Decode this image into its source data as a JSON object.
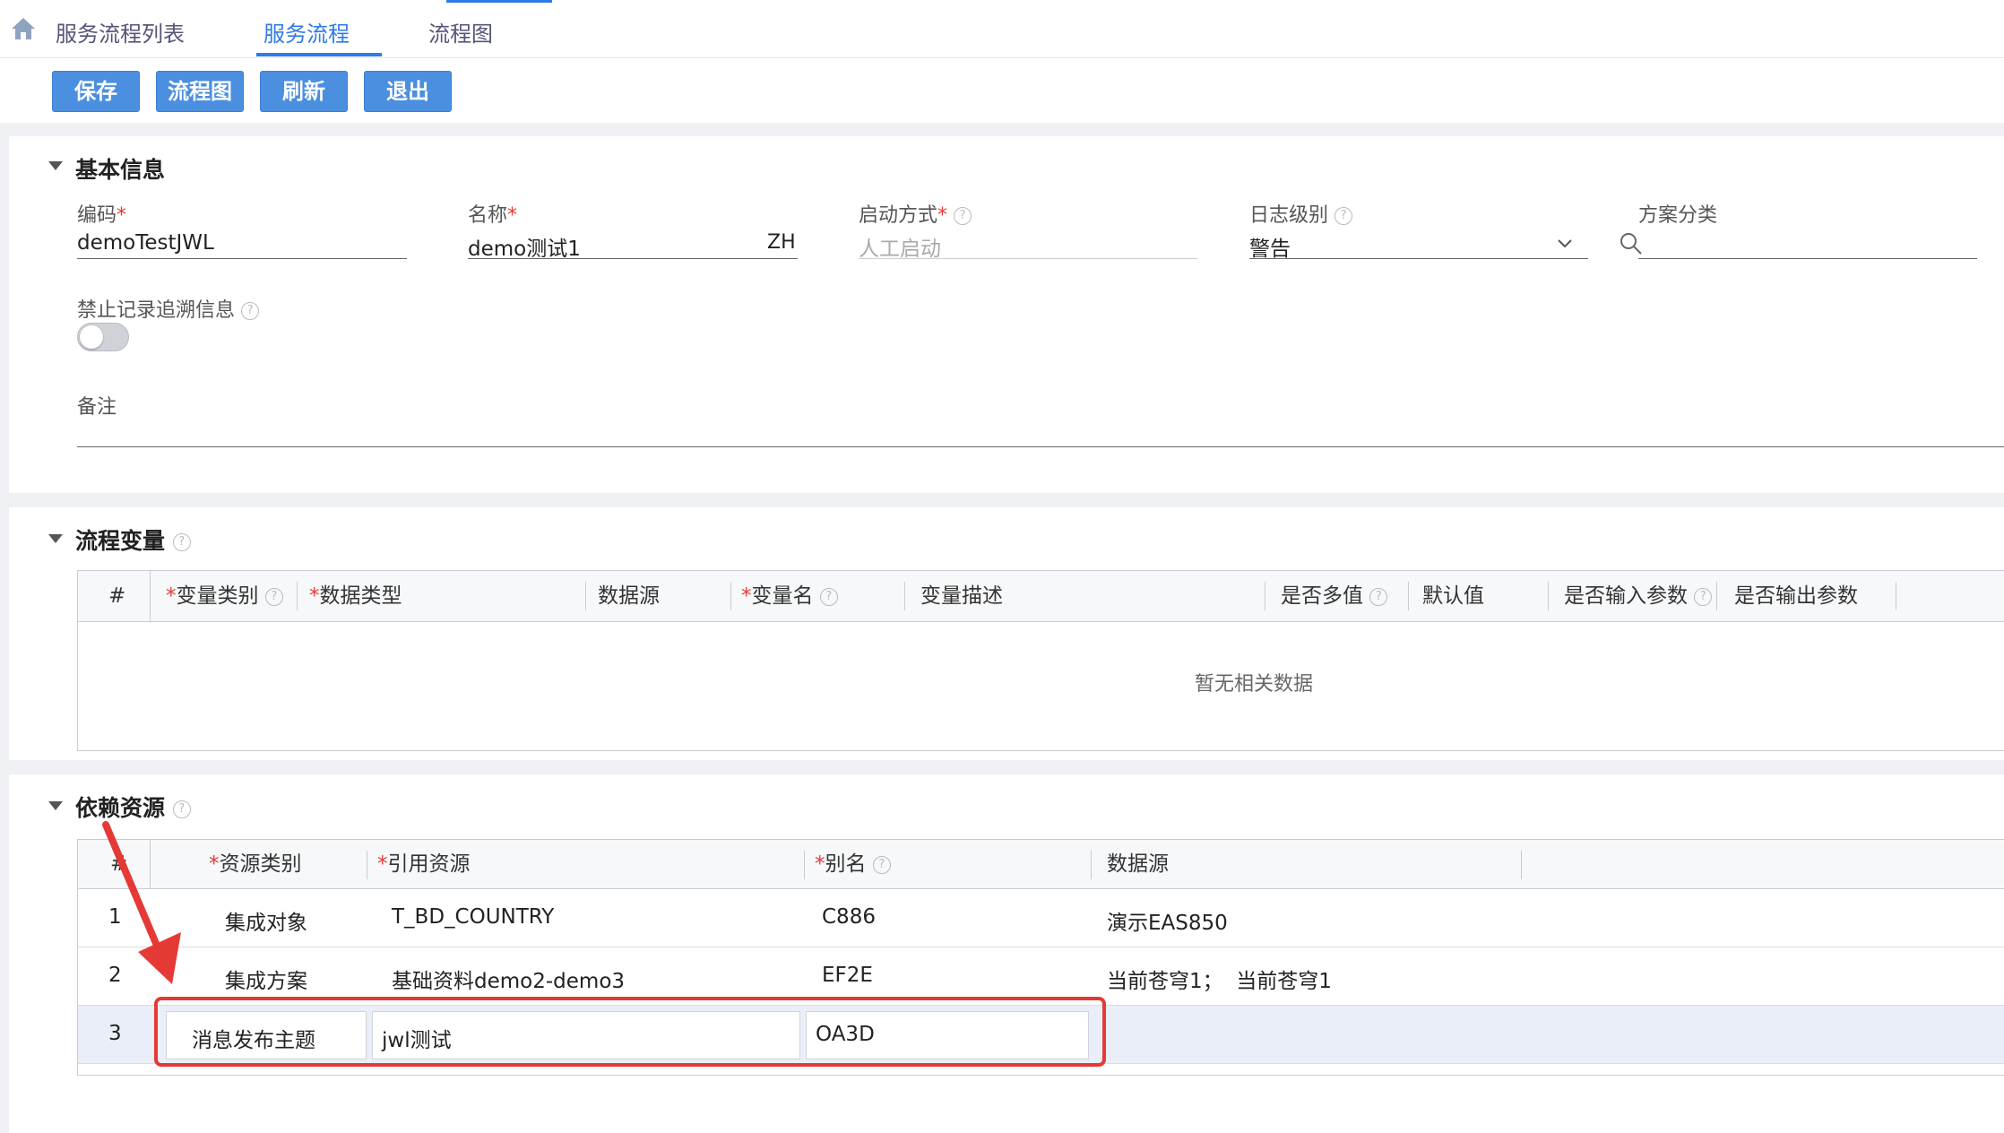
{
  "tabs": {
    "list_label": "服务流程列表",
    "flow_label": "服务流程",
    "chart_label": "流程图"
  },
  "toolbar": {
    "save": "保存",
    "flowchart": "流程图",
    "refresh": "刷新",
    "exit": "退出"
  },
  "basic": {
    "title": "基本信息",
    "code_label": "编码",
    "code_value": "demoTestJWL",
    "name_label": "名称",
    "name_value": "demo测试1",
    "name_lang": "ZH",
    "start_label": "启动方式",
    "start_value": "人工启动",
    "log_label": "日志级别",
    "log_value": "警告",
    "scheme_label": "方案分类",
    "trace_label": "禁止记录追溯信息",
    "remark_label": "备注"
  },
  "vars": {
    "title": "流程变量",
    "headers": [
      "#",
      "变量类别",
      "数据类型",
      "数据源",
      "变量名",
      "变量描述",
      "是否多值",
      "默认值",
      "是否输入参数",
      "是否输出参数"
    ],
    "empty": "暂无相关数据"
  },
  "deps": {
    "title": "依赖资源",
    "headers": [
      "#",
      "资源类别",
      "引用资源",
      "别名",
      "数据源"
    ],
    "rows": [
      {
        "no": "1",
        "type": "集成对象",
        "ref": "T_BD_COUNTRY",
        "alias": "C886",
        "source": "演示EAS850"
      },
      {
        "no": "2",
        "type": "集成方案",
        "ref": "基础资料demo2-demo3",
        "alias": "EF2E",
        "source": "当前苍穹1；  当前苍穹1"
      },
      {
        "no": "3",
        "type": "消息发布主题",
        "ref": "jwl测试",
        "alias": "OA3D",
        "source": ""
      }
    ]
  },
  "colors": {
    "accent": "#2f7be5",
    "button": "#4a8fe0",
    "annotation": "#e53935"
  }
}
